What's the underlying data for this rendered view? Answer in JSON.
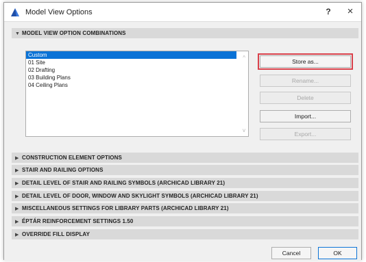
{
  "window": {
    "title": "Model View Options",
    "help_label": "?",
    "close_label": "×"
  },
  "main_section": {
    "header": "MODEL VIEW OPTION COMBINATIONS",
    "list_items": [
      {
        "label": "Custom",
        "selected": true
      },
      {
        "label": "01 Site",
        "selected": false
      },
      {
        "label": "02 Drafting",
        "selected": false
      },
      {
        "label": "03 Building Plans",
        "selected": false
      },
      {
        "label": "04 Ceiling Plans",
        "selected": false
      }
    ],
    "buttons": {
      "store_as": "Store as...",
      "rename": "Rename...",
      "delete": "Delete",
      "import": "Import...",
      "export": "Export..."
    }
  },
  "sections": [
    "CONSTRUCTION ELEMENT OPTIONS",
    "STAIR AND RAILING OPTIONS",
    "DETAIL LEVEL OF STAIR AND RAILING SYMBOLS (ARCHICAD LIBRARY 21)",
    "DETAIL LEVEL OF DOOR, WINDOW AND SKYLIGHT SYMBOLS (ARCHICAD LIBRARY 21)",
    "MISCELLANEOUS SETTINGS FOR LIBRARY PARTS (ARCHICAD LIBRARY 21)",
    "ÉPTÁR REINFORCEMENT SETTINGS 1.50",
    "OVERRIDE FILL DISPLAY"
  ],
  "footer": {
    "cancel": "Cancel",
    "ok": "OK"
  },
  "colors": {
    "selection": "#0a72d6",
    "highlight_outline": "#d9404a",
    "section_header_bg": "#d9d9d9"
  }
}
